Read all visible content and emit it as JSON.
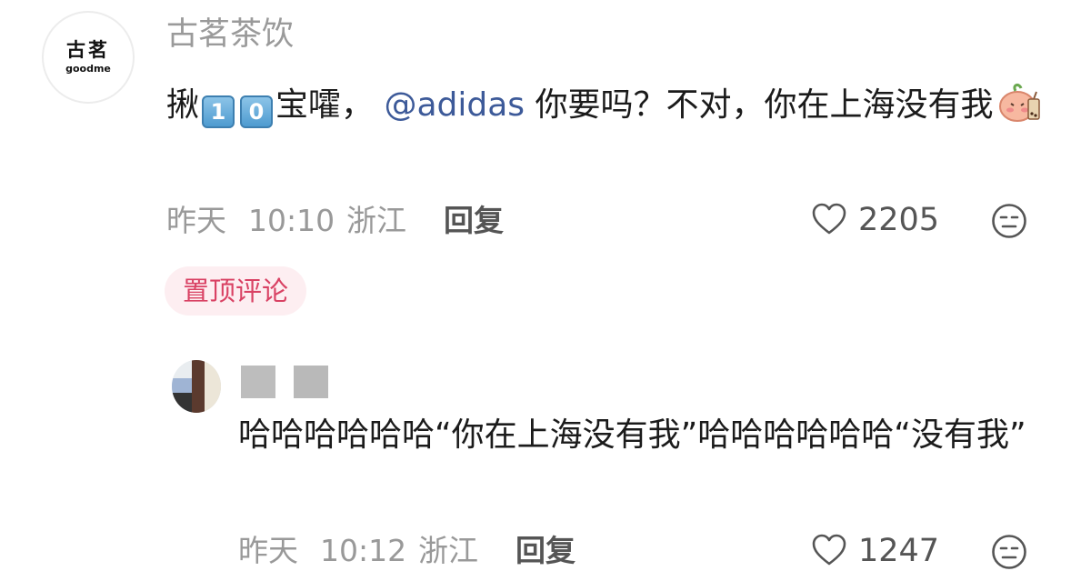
{
  "main_comment": {
    "avatar_logo_cn": "古茗",
    "avatar_logo_en": "goodme",
    "username": "古茗茶饮",
    "text_part1": "揪",
    "keycap_1": "1",
    "keycap_2": "0",
    "text_part2": "宝嚯，",
    "mention": "@adidas",
    "text_part3": " 你要吗？不对，你在上海没有我",
    "date": "昨天",
    "time": "10:10",
    "location": "浙江",
    "reply_label": "回复",
    "like_count": "2205",
    "pinned_label": "置顶评论"
  },
  "reply_comment": {
    "text": "哈哈哈哈哈哈“你在上海没有我”哈哈哈哈哈哈“没有我”",
    "date": "昨天",
    "time": "10:12",
    "location": "浙江",
    "reply_label": "回复",
    "like_count": "1247"
  },
  "colors": {
    "mention": "#3d5a99",
    "meta_gray": "#999999",
    "pin_bg": "#fdeef1",
    "pin_text": "#d94264"
  },
  "icons": [
    "heart-outline-icon",
    "neutral-face-icon",
    "peach-drink-emoji"
  ]
}
